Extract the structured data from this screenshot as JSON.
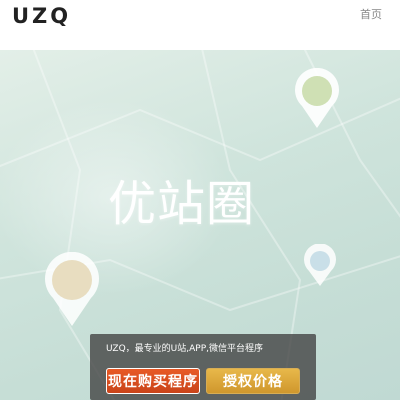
{
  "header": {
    "logo": "UZQ",
    "nav_home": "首页"
  },
  "hero": {
    "title": "优站圈",
    "promo_text": "UZQ，最专业的U站,APP,微信平台程序",
    "buy_button": "现在购买程序",
    "price_button": "授权价格"
  },
  "colors": {
    "buy_button": "#d94f20",
    "price_button": "#dcab3d",
    "hero_bg": "#cfe4dc"
  },
  "icons": [
    "location-pin-icon"
  ]
}
